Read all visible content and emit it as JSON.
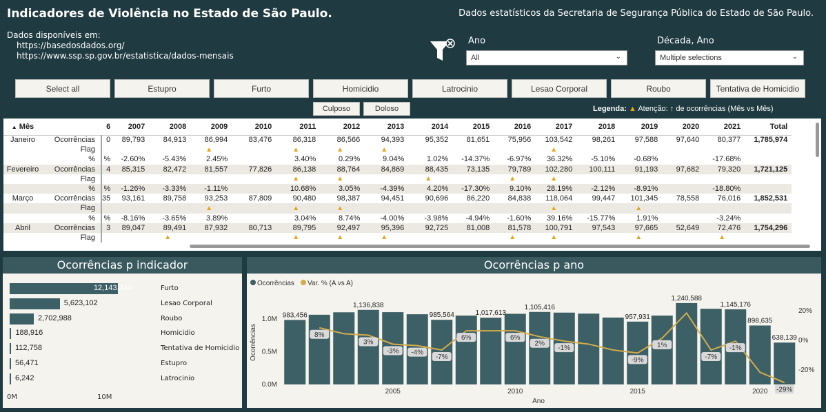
{
  "header": {
    "title": "Indicadores de Violência no Estado de São Paulo.",
    "subtitle": "Dados estatísticos da Secretaria de Segurança Pública do Estado de São Paulo.",
    "avail_label": "Dados disponíveis em:",
    "link1": "https://basedosdados.org/",
    "link2": "https://www.ssp.sp.gov.br/estatistica/dados-mensais"
  },
  "filters": {
    "ano_label": "Ano",
    "ano_value": "All",
    "decada_label": "Década, Ano",
    "decada_value": "Multiple selections"
  },
  "buttons": [
    "Select all",
    "Estupro",
    "Furto",
    "Homicidio",
    "Latrocinio",
    "Lesao Corporal",
    "Roubo",
    "Tentativa de Homicidio"
  ],
  "sub_buttons": [
    "Culposo",
    "Doloso"
  ],
  "legend": {
    "label": "Legenda:",
    "text": "Atenção: ↑ de ocorrências (Mês vs Mês)"
  },
  "table": {
    "col_mes": "Mês",
    "col_partial": "6",
    "years": [
      "2007",
      "2008",
      "2009",
      "2010",
      "2011",
      "2012",
      "2013",
      "2014",
      "2015",
      "2016",
      "2017",
      "2018",
      "2019",
      "2020",
      "2021"
    ],
    "col_total": "Total",
    "rows": [
      {
        "mes": "Janeiro",
        "lbl": "Ocorrências",
        "p": "0",
        "v": [
          "89,793",
          "84,913",
          "86,994",
          "83,476",
          "86,318",
          "86,566",
          "94,393",
          "95,352",
          "81,651",
          "75,956",
          "103,542",
          "98,261",
          "97,588",
          "97,640",
          "80,377"
        ],
        "t": "1,785,974",
        "alt": false
      },
      {
        "mes": "",
        "lbl": "Flag",
        "p": "",
        "v": [
          "",
          "",
          "▲",
          "",
          "▲",
          "▲",
          "▲",
          "",
          "",
          "",
          "▲",
          "",
          "",
          "",
          ""
        ],
        "t": "",
        "alt": false,
        "flag": true
      },
      {
        "mes": "",
        "lbl": "%",
        "p": "%",
        "v": [
          "-2.60%",
          "-5.43%",
          "2.45%",
          "",
          "3.40%",
          "0.29%",
          "9.04%",
          "1.02%",
          "-14.37%",
          "-6.97%",
          "36.32%",
          "-5.10%",
          "-0.68%",
          "",
          "-17.68%"
        ],
        "t": "",
        "alt": false
      },
      {
        "mes": "Fevereiro",
        "lbl": "Ocorrências",
        "p": "4",
        "v": [
          "85,315",
          "82,472",
          "81,557",
          "77,826",
          "86,138",
          "88,764",
          "84,869",
          "88,435",
          "73,135",
          "79,789",
          "102,280",
          "100,111",
          "91,193",
          "97,682",
          "79,320"
        ],
        "t": "1,721,125",
        "alt": true
      },
      {
        "mes": "",
        "lbl": "Flag",
        "p": "",
        "v": [
          "",
          "",
          "",
          "",
          "▲",
          "▲",
          "",
          "▲",
          "",
          "▲",
          "▲",
          "",
          "",
          "",
          ""
        ],
        "t": "",
        "alt": false,
        "flag": true
      },
      {
        "mes": "",
        "lbl": "%",
        "p": "%",
        "v": [
          "-1.26%",
          "-3.33%",
          "-1.11%",
          "",
          "10.68%",
          "3.05%",
          "-4.39%",
          "4.20%",
          "-17.30%",
          "9.10%",
          "28.19%",
          "-2.12%",
          "-8.91%",
          "",
          "-18.80%"
        ],
        "t": "",
        "alt": true
      },
      {
        "mes": "Março",
        "lbl": "Ocorrências",
        "p": "35",
        "v": [
          "93,161",
          "89,758",
          "93,253",
          "87,809",
          "90,480",
          "98,387",
          "94,451",
          "90,696",
          "86,220",
          "84,838",
          "118,064",
          "99,447",
          "101,345",
          "78,558",
          "76,016"
        ],
        "t": "1,852,531",
        "alt": false
      },
      {
        "mes": "",
        "lbl": "Flag",
        "p": "",
        "v": [
          "",
          "",
          "▲",
          "",
          "▲",
          "▲",
          "",
          "",
          "",
          "",
          "▲",
          "",
          "▲",
          "",
          ""
        ],
        "t": "",
        "alt": true,
        "flag": true
      },
      {
        "mes": "",
        "lbl": "%",
        "p": "%",
        "v": [
          "-8.16%",
          "-3.65%",
          "3.89%",
          "",
          "3.04%",
          "8.74%",
          "-4.00%",
          "-3.98%",
          "-4.94%",
          "-1.60%",
          "39.16%",
          "-15.77%",
          "1.91%",
          "",
          "-3.24%"
        ],
        "t": "",
        "alt": false
      },
      {
        "mes": "Abril",
        "lbl": "Ocorrências",
        "p": "3",
        "v": [
          "89,047",
          "89,491",
          "87,932",
          "80,713",
          "89,795",
          "92,497",
          "95,396",
          "92,725",
          "81,008",
          "81,578",
          "100,791",
          "97,543",
          "97,665",
          "52,649",
          "72,476"
        ],
        "t": "1,754,296",
        "alt": true
      },
      {
        "mes": "",
        "lbl": "Flag",
        "p": "",
        "v": [
          "",
          "▲",
          "",
          "",
          "▲",
          "▲",
          "▲",
          "",
          "",
          "▲",
          "▲",
          "",
          "▲",
          "",
          "▲"
        ],
        "t": "",
        "alt": false,
        "flag": true
      }
    ]
  },
  "indicador_panel": {
    "title": "Ocorrências p indicador",
    "axis": [
      "0M",
      "10M"
    ],
    "chart_data": {
      "type": "bar",
      "categories": [
        "Furto",
        "Lesao Corporal",
        "Roubo",
        "Homicidio",
        "Tentativa de Homicidio",
        "Estupro",
        "Latrocinio"
      ],
      "values": [
        12143240,
        5623102,
        2702988,
        188916,
        112758,
        56471,
        6242
      ],
      "labels": [
        "12,143,240",
        "5,623,102",
        "2,702,988",
        "188,916",
        "112,758",
        "56,471",
        "6,242"
      ],
      "xlim": [
        0,
        13000000
      ]
    }
  },
  "ano_panel": {
    "title": "Ocorrências p ano",
    "legend": [
      "Ocorrências",
      "Var. % (A vs A)"
    ],
    "colors": {
      "bar": "#3d5f66",
      "line": "#d4ac4a"
    },
    "chart_data": {
      "type": "bar+line",
      "xlabel": "Ano",
      "ylabel": "Ocorrências",
      "x": [
        2001,
        2002,
        2003,
        2004,
        2005,
        2006,
        2007,
        2008,
        2009,
        2010,
        2011,
        2012,
        2013,
        2014,
        2015,
        2016,
        2017,
        2018,
        2019,
        2020,
        2021
      ],
      "bars": [
        983456,
        1063000,
        1100000,
        1136838,
        1102000,
        1070000,
        985564,
        1050000,
        1017613,
        1077000,
        1105416,
        1095000,
        1080000,
        1020000,
        957931,
        1050000,
        1240588,
        1154000,
        1145176,
        898635,
        638139
      ],
      "bar_labels": {
        "2001": "983,456",
        "2004": "1,136,838",
        "2007": "985,564",
        "2009": "1,017,613",
        "2011": "1,105,416",
        "2015": "957,931",
        "2017": "1,240,588",
        "2019": "1,145,176",
        "2020": "898,635",
        "2021": "638,139"
      },
      "line": [
        null,
        8,
        4,
        3,
        -3,
        -4,
        -7,
        6,
        6,
        6,
        2,
        -1,
        -3,
        -7,
        -9,
        1,
        18,
        -7,
        -1,
        -22,
        -29
      ],
      "line_labels": {
        "2002": "8%",
        "2004": "3%",
        "2005": "-3%",
        "2006": "-4%",
        "2007": "-7%",
        "2008": "6%",
        "2010": "6%",
        "2011": "2%",
        "2012": "-1%",
        "2015": "-9%",
        "2016": "1%",
        "2018": "-7%",
        "2019": "-1%",
        "2021": "-29%"
      },
      "yticks": [
        "0.0M",
        "0.5M",
        "1.0M"
      ],
      "y2ticks": [
        "20%",
        "0%",
        "-20%"
      ],
      "xticks": [
        "2005",
        "2010",
        "2015",
        "2020"
      ]
    }
  }
}
